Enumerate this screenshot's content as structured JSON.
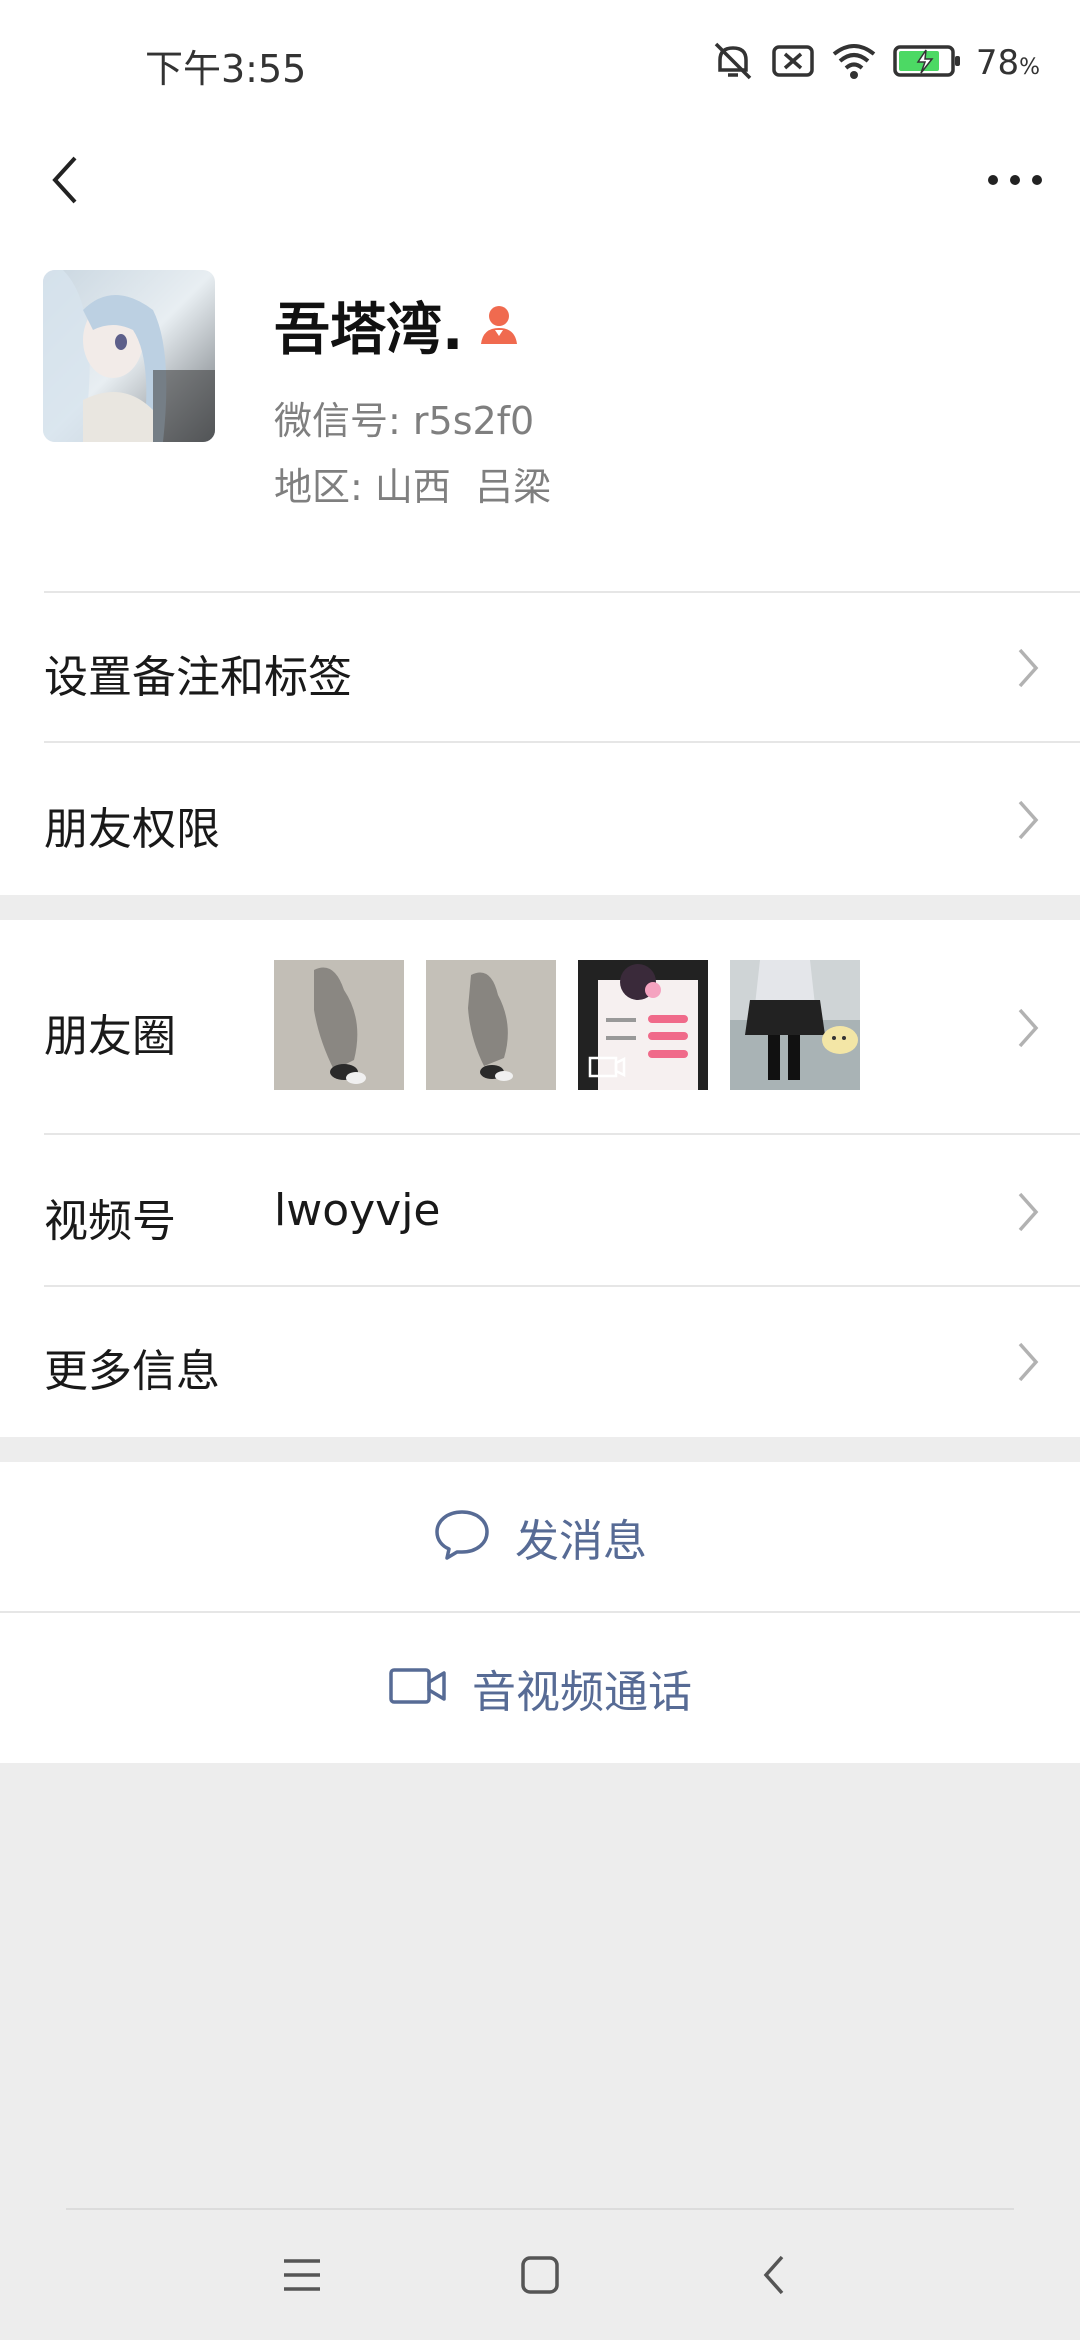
{
  "status_bar": {
    "time": "下午3:55",
    "battery_percent": "78",
    "battery_unit": "%",
    "icons": [
      "mute-icon",
      "sim-off-icon",
      "wifi-icon",
      "battery-charging-icon"
    ]
  },
  "nav": {
    "back_icon": "back-arrow-icon",
    "more_icon": "more-dots-icon"
  },
  "profile": {
    "name": "吾塔湾.",
    "gender_icon": "female-icon",
    "wxid_label": "微信号:",
    "wxid": "r5s2f0",
    "region_label": "地区:",
    "region": "山西  吕梁"
  },
  "rows": {
    "remark_tags": "设置备注和标签",
    "friend_permissions": "朋友权限",
    "moments": "朋友圈",
    "channels": "视频号",
    "channels_value": "lwoyvje",
    "more_info": "更多信息"
  },
  "actions": {
    "send_message": "发消息",
    "av_call": "音视频通话"
  },
  "system_nav": [
    "menu-icon",
    "home-icon",
    "back-icon"
  ],
  "colors": {
    "link_blue": "#576b95",
    "female_accent": "#f06a4f",
    "page_bg": "#ededed"
  }
}
